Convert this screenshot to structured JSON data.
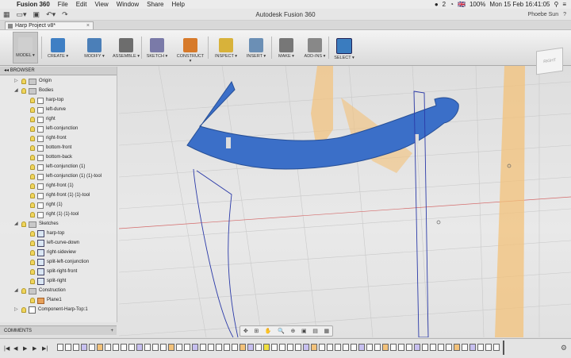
{
  "menubar": {
    "apple": "",
    "items": [
      "Fusion 360",
      "File",
      "Edit",
      "View",
      "Window",
      "Share",
      "Help"
    ],
    "badge": "2",
    "battery": "100%",
    "flag": "🇬🇧",
    "clock": "Mon 15 Feb  16:41:05"
  },
  "window": {
    "title": "Autodesk Fusion 360",
    "user": "Phoebe Sun",
    "help": "?"
  },
  "doc_tab": {
    "label": "Harp Project v8*",
    "close": "×"
  },
  "toolbar": [
    {
      "label": "MODEL ▾",
      "color": "#cfcfcf"
    },
    {
      "label": "CREATE ▾",
      "color": "#3f7fc4"
    },
    {
      "label": "MODIFY ▾",
      "color": "#4b7fb8"
    },
    {
      "label": "ASSEMBLE ▾",
      "color": "#6d6d6d"
    },
    {
      "label": "SKETCH ▾",
      "color": "#7a7aa8"
    },
    {
      "label": "CONSTRUCT ▾",
      "color": "#d77a2a"
    },
    {
      "label": "INSPECT ▾",
      "color": "#d8b23a"
    },
    {
      "label": "INSERT ▾",
      "color": "#6b8fb5"
    },
    {
      "label": "MAKE ▾",
      "color": "#777777"
    },
    {
      "label": "ADD-INS ▾",
      "color": "#888888"
    },
    {
      "label": "SELECT ▾",
      "color": "#3a7cbf"
    }
  ],
  "viewcube": "RIGHT",
  "browser": {
    "title": "BROWSER",
    "items": [
      {
        "label": "Origin",
        "level": 0,
        "kind": "folder",
        "tri": "▷"
      },
      {
        "label": "Bodies",
        "level": 0,
        "kind": "folder",
        "tri": "◢"
      },
      {
        "label": "harp-top",
        "level": 1,
        "kind": "body"
      },
      {
        "label": "left-durve",
        "level": 1,
        "kind": "body"
      },
      {
        "label": "right",
        "level": 1,
        "kind": "body"
      },
      {
        "label": "left-conjunction",
        "level": 1,
        "kind": "body"
      },
      {
        "label": "right-front",
        "level": 1,
        "kind": "body"
      },
      {
        "label": "bottom-front",
        "level": 1,
        "kind": "body"
      },
      {
        "label": "bottom-back",
        "level": 1,
        "kind": "body"
      },
      {
        "label": "left-conjunction (1)",
        "level": 1,
        "kind": "body"
      },
      {
        "label": "left-conjunction (1) (1)-tool",
        "level": 1,
        "kind": "body"
      },
      {
        "label": "right-front (1)",
        "level": 1,
        "kind": "body"
      },
      {
        "label": "right-front (1) (1)-tool",
        "level": 1,
        "kind": "body"
      },
      {
        "label": "right (1)",
        "level": 1,
        "kind": "body"
      },
      {
        "label": "right (1) (1)-tool",
        "level": 1,
        "kind": "body"
      },
      {
        "label": "Sketches",
        "level": 0,
        "kind": "folder",
        "tri": "◢"
      },
      {
        "label": "harp-top",
        "level": 1,
        "kind": "sketch"
      },
      {
        "label": "left-curve-down",
        "level": 1,
        "kind": "sketch"
      },
      {
        "label": "right-sideview",
        "level": 1,
        "kind": "sketch"
      },
      {
        "label": "split-left-conjunction",
        "level": 1,
        "kind": "sketch"
      },
      {
        "label": "split-right-front",
        "level": 1,
        "kind": "sketch"
      },
      {
        "label": "split-right",
        "level": 1,
        "kind": "sketch"
      },
      {
        "label": "Construction",
        "level": 0,
        "kind": "folder",
        "tri": "◢"
      },
      {
        "label": "Plane1",
        "level": 1,
        "kind": "plane"
      },
      {
        "label": "Component-Harp-Top:1",
        "level": 0,
        "kind": "component",
        "tri": "▷"
      }
    ]
  },
  "comments": {
    "label": "COMMENTS",
    "plus": "+"
  },
  "nav_icons": [
    "✥",
    "⊞",
    "✋",
    "🔍",
    "⊕",
    "▣",
    "▤",
    "▦"
  ],
  "timeline": {
    "controls": [
      "|◀",
      "◀",
      "▶",
      "▶",
      "▶|"
    ],
    "gear": "⚙"
  },
  "colors": {
    "body": "#3b6fc8",
    "plane": "#f3c27a",
    "sketch": "#2b3aa8"
  }
}
